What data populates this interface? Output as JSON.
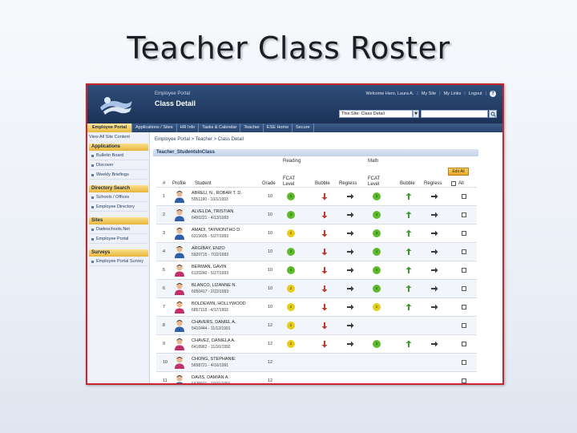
{
  "slide": {
    "title": "Teacher Class Roster"
  },
  "header": {
    "portal_name": "Employee Portal",
    "page_name": "Class Detail",
    "links": [
      "Welcome Hero, Laura A.",
      "My Site",
      "My Links",
      "Logout"
    ],
    "search_scope": "This Site: Class Detail"
  },
  "nav": {
    "tabs": [
      "Employee Portal",
      "Applications / Sites",
      "HR Info",
      "Tasks & Calendar",
      "Teacher",
      "ESE Home",
      "Secure"
    ]
  },
  "sidebar": {
    "top_link": "View All Site Content",
    "sections": [
      {
        "title": "Applications",
        "items": [
          "Bulletin Board",
          "Discover",
          "Weekly Briefings"
        ]
      },
      {
        "title": "Directory Search",
        "items": [
          "Schools / Offices",
          "Employee Directory"
        ]
      },
      {
        "title": "Sites",
        "items": [
          "Dadeschools.Net",
          "Employee Portal"
        ]
      },
      {
        "title": "Surveys",
        "items": [
          "Employee Portal Survey"
        ]
      }
    ]
  },
  "content": {
    "breadcrumb": "Employee Portal  >  Teacher  >  Class Detail",
    "webpart_title": "Teacher_StudentsInClass",
    "groups": {
      "reading": "Reading",
      "math": "Math"
    },
    "columns": {
      "num": "#",
      "profile": "Profile",
      "student": "Student",
      "grade": "Grade",
      "fcat_level_r": "FCAT Level",
      "bubble_r": "Bubble",
      "regress_r": "Regress",
      "fcat_level_m": "FCAT Level",
      "bubble_m": "Bubble",
      "regress_m": "Regress",
      "all": "All"
    },
    "edit_all_label": "Edit All"
  },
  "colors": {
    "level_green": "#5dbb2b",
    "level_yellow": "#e6cc1f",
    "arrow_down_red": "#c0392b",
    "arrow_up_green": "#3f9a2f",
    "arrow_right_dark": "#3c3c3c"
  },
  "students": [
    {
      "num": "1",
      "name": "ABREU, N., ROBAR T. D.",
      "sub": "5951190 - 10/1/1993",
      "grade": "10",
      "gender": "m",
      "r_level": "3",
      "r_color": "green",
      "r_bubble": "down",
      "r_regress": "right",
      "m_level": "3",
      "m_color": "green",
      "m_bubble": "up",
      "m_regress": "right"
    },
    {
      "num": "2",
      "name": "ALVELDA, TRISTIAN",
      "sub": "6450221 - 4/13/1993",
      "grade": "10",
      "gender": "m",
      "r_level": "3",
      "r_color": "green",
      "r_bubble": "down",
      "r_regress": "right",
      "m_level": "3",
      "m_color": "green",
      "m_bubble": "up",
      "m_regress": "right"
    },
    {
      "num": "3",
      "name": "AMADI, TAYMONTHO D.",
      "sub": "6315605 - 5/27/1993",
      "grade": "10",
      "gender": "m",
      "r_level": "2",
      "r_color": "yellow",
      "r_bubble": "down",
      "r_regress": "right",
      "m_level": "3",
      "m_color": "green",
      "m_bubble": "up",
      "m_regress": "right"
    },
    {
      "num": "4",
      "name": "ARGIBAY, ENZO",
      "sub": "5920715 - 7/22/1993",
      "grade": "10",
      "gender": "m",
      "r_level": "3",
      "r_color": "green",
      "r_bubble": "down",
      "r_regress": "right",
      "m_level": "4",
      "m_color": "green",
      "m_bubble": "up",
      "m_regress": "right"
    },
    {
      "num": "5",
      "name": "BERMAN, GAVIN",
      "sub": "6120240 - 5/27/1993",
      "grade": "10",
      "gender": "f",
      "r_level": "4",
      "r_color": "green",
      "r_bubble": "down",
      "r_regress": "right",
      "m_level": "4",
      "m_color": "green",
      "m_bubble": "up",
      "m_regress": "right"
    },
    {
      "num": "6",
      "name": "BLANCO, LIZANNE N.",
      "sub": "6050417 - 2/22/1993",
      "grade": "10",
      "gender": "f",
      "r_level": "2",
      "r_color": "yellow",
      "r_bubble": "down",
      "r_regress": "right",
      "m_level": "4",
      "m_color": "green",
      "m_bubble": "up",
      "m_regress": "right"
    },
    {
      "num": "7",
      "name": "BOLDEWIN, HOLLYWOOD",
      "sub": "6857118 - 4/17/1993",
      "grade": "10",
      "gender": "f",
      "r_level": "2",
      "r_color": "yellow",
      "r_bubble": "down",
      "r_regress": "right",
      "m_level": "2",
      "m_color": "yellow",
      "m_bubble": "up",
      "m_regress": "right"
    },
    {
      "num": "8",
      "name": "CHAVERS, DANIEL A.",
      "sub": "5410444 - 11/12/1991",
      "grade": "12",
      "gender": "m",
      "r_level": "2",
      "r_color": "yellow",
      "r_bubble": "down",
      "r_regress": "right",
      "m_level": "",
      "m_color": "",
      "m_bubble": "",
      "m_regress": ""
    },
    {
      "num": "9",
      "name": "CHAVEZ, DANIELA A.",
      "sub": "6418962 - 11/16/1992",
      "grade": "12",
      "gender": "f",
      "r_level": "2",
      "r_color": "yellow",
      "r_bubble": "down",
      "r_regress": "right",
      "m_level": "3",
      "m_color": "green",
      "m_bubble": "up",
      "m_regress": "right"
    },
    {
      "num": "10",
      "name": "CHONG, STEPHANIE",
      "sub": "5658721 - 4/16/1991",
      "grade": "12",
      "gender": "f",
      "r_level": "",
      "r_color": "",
      "r_bubble": "",
      "r_regress": "",
      "m_level": "",
      "m_color": "",
      "m_bubble": "",
      "m_regress": ""
    },
    {
      "num": "11",
      "name": "DAVIS, DAMIAN A.",
      "sub": "6475501 - 10/11/1991",
      "grade": "12",
      "gender": "m",
      "r_level": "",
      "r_color": "",
      "r_bubble": "",
      "r_regress": "",
      "m_level": "",
      "m_color": "",
      "m_bubble": "",
      "m_regress": ""
    }
  ]
}
